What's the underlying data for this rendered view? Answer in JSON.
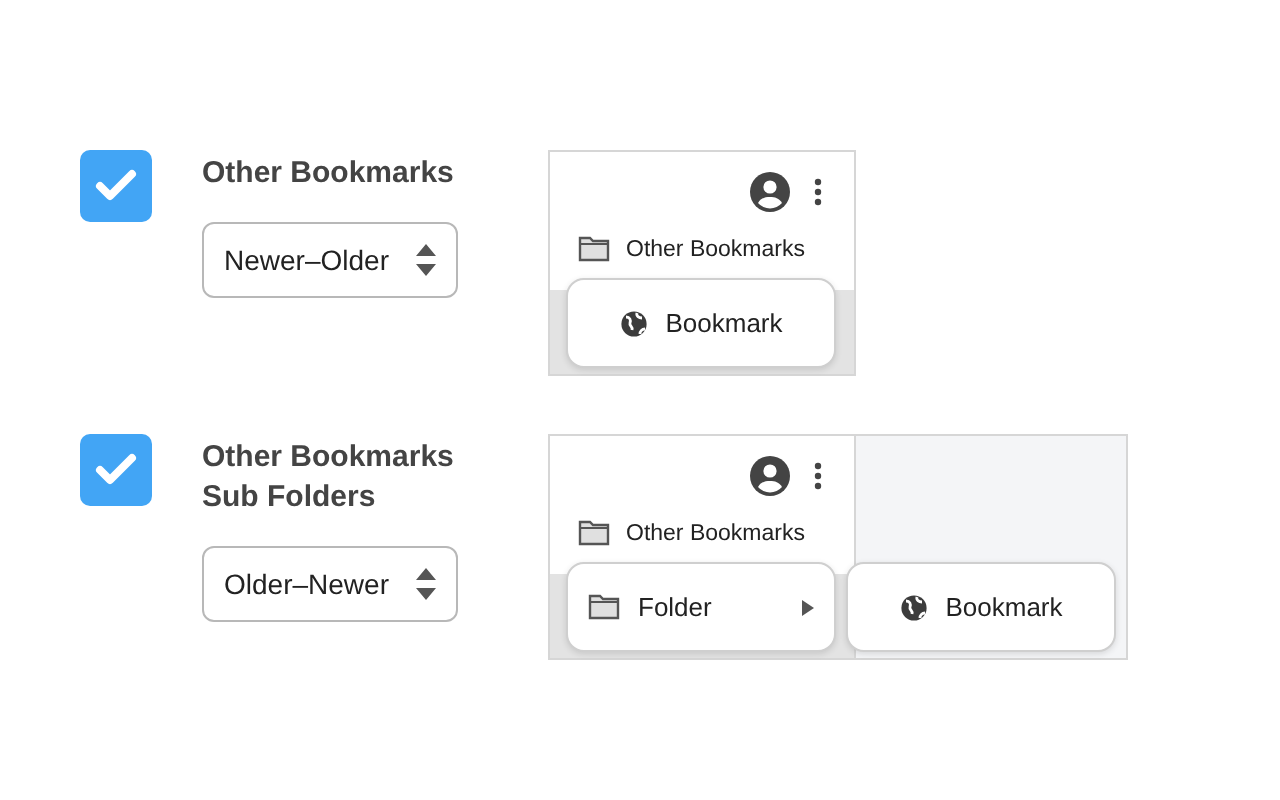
{
  "sections": [
    {
      "checked": true,
      "title": "Other Bookmarks",
      "sort": "Newer–Older",
      "preview": {
        "folder_label": "Other Bookmarks",
        "menus": [
          {
            "items": [
              {
                "kind": "bookmark",
                "label": "Bookmark"
              }
            ]
          }
        ]
      }
    },
    {
      "checked": true,
      "title": "Other Bookmarks Sub Folders",
      "sort": "Older–Newer",
      "preview": {
        "folder_label": "Other Bookmarks",
        "menus": [
          {
            "items": [
              {
                "kind": "folder",
                "label": "Folder"
              }
            ]
          },
          {
            "items": [
              {
                "kind": "bookmark",
                "label": "Bookmark"
              }
            ]
          }
        ]
      }
    }
  ]
}
